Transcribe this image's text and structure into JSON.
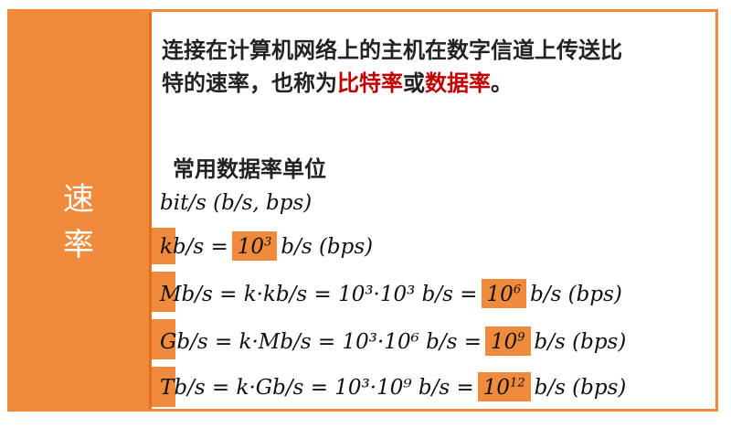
{
  "side_label": [
    "速",
    "率"
  ],
  "intro": {
    "line1": "连接在计算机网络上的主机在数字信道上传送比",
    "line2_pre": "特的速率，也称为",
    "hl1": "比特率",
    "or": "或",
    "hl2": "数据率",
    "end": "。"
  },
  "units_title": "常用数据率单位",
  "formulas": {
    "bits": "bit/s  (b/s,  bps)",
    "kb": {
      "lhs": "kb/s  =",
      "base": "10",
      "exp": "3",
      "rhs": "b/s  (bps)"
    },
    "mb": {
      "lhs": "Mb/s  =  k·kb/s  =  10³·10³  b/s  =",
      "base": "10",
      "exp": "6",
      "rhs": "b/s  (bps)"
    },
    "gb": {
      "lhs": "Gb/s  =  k·Mb/s  =  10³·10⁶  b/s  =",
      "base": "10",
      "exp": "9",
      "rhs": "b/s  (bps)"
    },
    "tb": {
      "lhs": "Tb/s  =  k·Gb/s  =  10³·10⁹  b/s  =",
      "base": "10",
      "exp": "12",
      "rhs": "b/s  (bps)"
    }
  },
  "colors": {
    "accent": "#f08a3c",
    "highlight": "#c00000"
  }
}
